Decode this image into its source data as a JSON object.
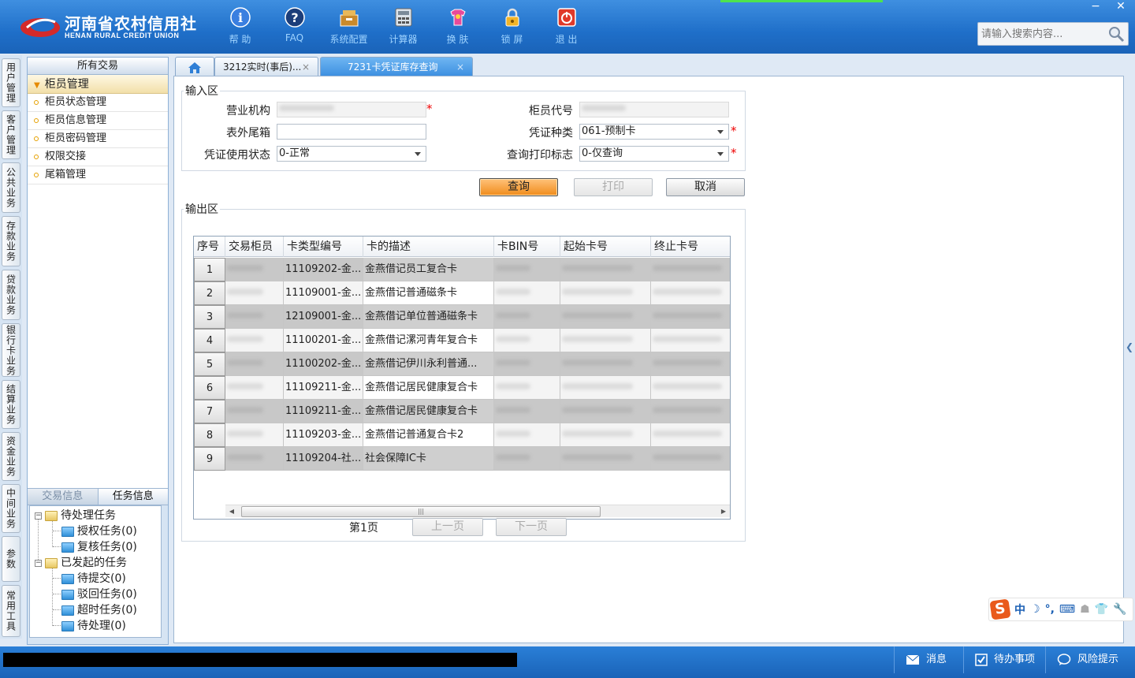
{
  "header": {
    "logo_cn": "河南省农村信用社",
    "logo_en": "HENAN RURAL CREDIT UNION",
    "toolbar": [
      {
        "label": "帮 助",
        "icon": "help-icon"
      },
      {
        "label": "FAQ",
        "icon": "faq-icon"
      },
      {
        "label": "系统配置",
        "icon": "config-icon"
      },
      {
        "label": "计算器",
        "icon": "calculator-icon"
      },
      {
        "label": "换 肤",
        "icon": "skin-icon"
      },
      {
        "label": "锁 屏",
        "icon": "lock-icon"
      },
      {
        "label": "退 出",
        "icon": "exit-icon"
      }
    ],
    "window_min": "−",
    "window_close": "✕",
    "search_placeholder": "请输入搜索内容..."
  },
  "vtabs": [
    "用户管理",
    "客户管理",
    "公共业务",
    "存款业务",
    "贷款业务",
    "银行卡业务",
    "结算业务",
    "资金业务",
    "中间业务",
    "参数",
    "常用工具"
  ],
  "leftpanel": {
    "title": "所有交易",
    "group": "柜员管理",
    "items": [
      "柜员状态管理",
      "柜员信息管理",
      "柜员密码管理",
      "权限交接",
      "尾箱管理"
    ],
    "tabs": [
      "交易信息",
      "任务信息"
    ],
    "tree": {
      "pending": "待处理任务",
      "pending_children": [
        "授权任务(0)",
        "复核任务(0)"
      ],
      "initiated": "已发起的任务",
      "initiated_children": [
        "待提交(0)",
        "驳回任务(0)",
        "超时任务(0)",
        "待处理(0)"
      ]
    }
  },
  "tabs": [
    {
      "label": "3212实时(事后)...",
      "close": "×"
    },
    {
      "label": "7231卡凭证库存查询",
      "close": "×"
    }
  ],
  "input_area": {
    "legend": "输入区",
    "fields": {
      "org_label": "营业机构",
      "teller_label": "柜员代号",
      "tailbox_label": "表外尾箱",
      "voucher_type_label": "凭证种类",
      "voucher_type_value": "061-预制卡",
      "use_status_label": "凭证使用状态",
      "use_status_value": "0-正常",
      "print_flag_label": "查询打印标志",
      "print_flag_value": "0-仅查询"
    },
    "required_mark": "*"
  },
  "buttons": {
    "query": "查询",
    "print": "打印",
    "cancel": "取消"
  },
  "output_area": {
    "legend": "输出区",
    "columns": [
      "序号",
      "交易柜员",
      "卡类型编号",
      "卡的描述",
      "卡BIN号",
      "起始卡号",
      "终止卡号"
    ],
    "rows": [
      {
        "seq": "1",
        "type": "11109202-金...",
        "desc": "金燕借记员工复合卡"
      },
      {
        "seq": "2",
        "type": "11109001-金...",
        "desc": "金燕借记普通磁条卡"
      },
      {
        "seq": "3",
        "type": "12109001-金...",
        "desc": "金燕借记单位普通磁条卡"
      },
      {
        "seq": "4",
        "type": "11100201-金...",
        "desc": "金燕借记漯河青年复合卡"
      },
      {
        "seq": "5",
        "type": "11100202-金...",
        "desc": "金燕借记伊川永利普通..."
      },
      {
        "seq": "6",
        "type": "11109211-金...",
        "desc": "金燕借记居民健康复合卡"
      },
      {
        "seq": "7",
        "type": "11109211-金...",
        "desc": "金燕借记居民健康复合卡"
      },
      {
        "seq": "8",
        "type": "11109203-金...",
        "desc": "金燕借记普通复合卡2"
      },
      {
        "seq": "9",
        "type": "11109204-社...",
        "desc": "社会保障IC卡"
      }
    ],
    "page_label": "第1页",
    "prev": "上一页",
    "next": "下一页"
  },
  "ime": {
    "items": [
      "中",
      "☽",
      "°,",
      "⌨",
      "☗",
      "👕",
      "🔧"
    ]
  },
  "statusbar": {
    "message": "消息",
    "todo": "待办事项",
    "risk": "风险提示"
  },
  "colors": {
    "header": "#1f6fc9",
    "accent_orange": "#f08b1a",
    "required": "#e00000"
  }
}
